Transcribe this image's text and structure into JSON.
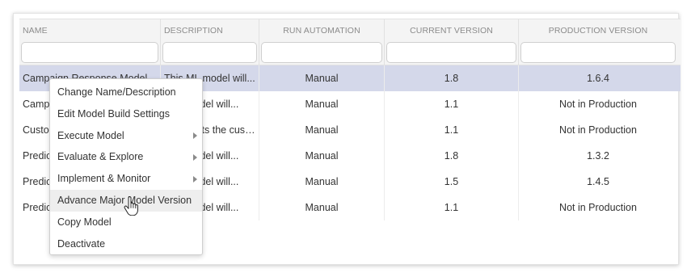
{
  "columns": [
    {
      "label": "NAME",
      "filter_value": ""
    },
    {
      "label": "DESCRIPTION",
      "filter_value": ""
    },
    {
      "label": "RUN AUTOMATION",
      "filter_value": ""
    },
    {
      "label": "CURRENT VERSION",
      "filter_value": ""
    },
    {
      "label": "PRODUCTION VERSION",
      "filter_value": ""
    }
  ],
  "rows": [
    {
      "name": "Campaign Response Model",
      "description": "This ML model will...",
      "run_automation": "Manual",
      "current_version": "1.8",
      "production_version": "1.6.4",
      "selected": true
    },
    {
      "name": "Campaign Response Model",
      "description": "This model will...",
      "run_automation": "Manual",
      "current_version": "1.1",
      "production_version": "Not in Production",
      "selected": false
    },
    {
      "name": "Customer Segmentation",
      "description": "Segments the custo...",
      "run_automation": "Manual",
      "current_version": "1.1",
      "production_version": "Not in Production",
      "selected": false
    },
    {
      "name": "Predictive Churn Model",
      "description": "This model will...",
      "run_automation": "Manual",
      "current_version": "1.8",
      "production_version": "1.3.2",
      "selected": false
    },
    {
      "name": "Predictive Upsell Model",
      "description": "This model will...",
      "run_automation": "Manual",
      "current_version": "1.5",
      "production_version": "1.4.5",
      "selected": false
    },
    {
      "name": "Predictive LTV Model",
      "description": "This model will...",
      "run_automation": "Manual",
      "current_version": "1.1",
      "production_version": "Not in Production",
      "selected": false
    }
  ],
  "context_menu": {
    "items": [
      {
        "label": "Change Name/Description",
        "submenu": false
      },
      {
        "label": "Edit Model Build Settings",
        "submenu": false
      },
      {
        "label": "Execute Model",
        "submenu": true
      },
      {
        "label": "Evaluate & Explore",
        "submenu": true
      },
      {
        "label": "Implement & Monitor",
        "submenu": true
      },
      {
        "label": "Advance Major Model Version",
        "submenu": false,
        "hovered": true
      },
      {
        "label": "Copy Model",
        "submenu": false
      },
      {
        "label": "Deactivate",
        "submenu": false
      }
    ]
  },
  "colors": {
    "selected_row": "#d4d8ea",
    "header_bg": "#f4f4f4",
    "menu_hover": "#eeeeee"
  },
  "icons": {
    "submenu_arrow": "chevron-right-icon",
    "cursor": "hand-pointer-icon"
  }
}
